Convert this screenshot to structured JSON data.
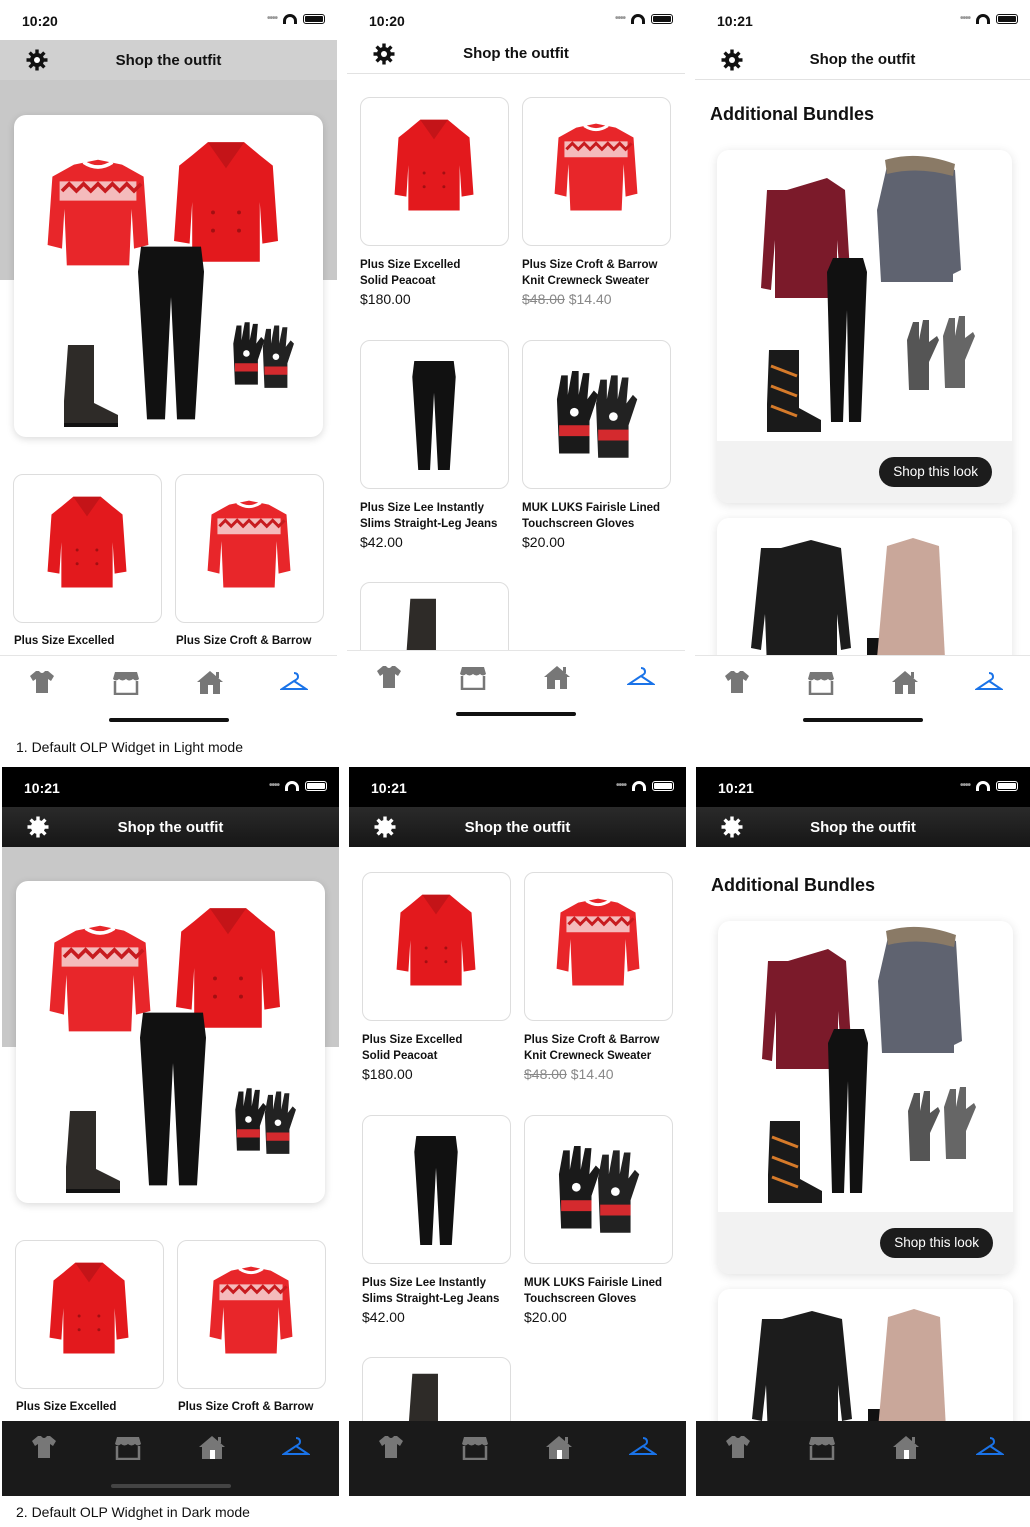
{
  "time_a": "10:20",
  "time_b": "10:21",
  "nav_title": "Shop the outfit",
  "section_title": "Additional Bundles",
  "shop_button": "Shop this look",
  "products": [
    {
      "name1": "Plus Size Excelled",
      "name2": "Solid Peacoat",
      "price": "$180.00"
    },
    {
      "name1": "Plus Size Croft & Barrow",
      "name2": "Knit Crewneck Sweater",
      "old_price": "$48.00",
      "price": "$14.40"
    },
    {
      "name1": "Plus Size Lee Instantly",
      "name2": "Slims Straight-Leg Jeans",
      "price": "$42.00"
    },
    {
      "name1": "MUK LUKS Fairisle Lined",
      "name2": "Touchscreen Gloves",
      "price": "$20.00"
    }
  ],
  "tabs": [
    "shirt-icon",
    "store-icon",
    "home-icon",
    "hanger-icon"
  ],
  "captions": {
    "light": "1. Default OLP Widget in Light mode",
    "dark": "2. Default OLP Widghet in Dark mode"
  },
  "colors": {
    "accent": "#1a73e8",
    "red": "#e8262a",
    "dark_nav": "#1c1c1c"
  }
}
